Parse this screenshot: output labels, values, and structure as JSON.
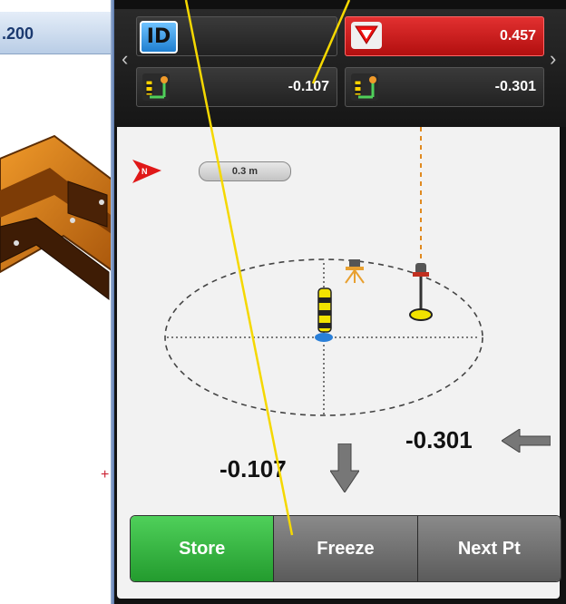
{
  "cad": {
    "header_value": ".200",
    "crosshair": "+"
  },
  "nav": {
    "left_arrow": "‹",
    "right_arrow": "›"
  },
  "top_fields": {
    "id_badge": "ID",
    "id_value": "",
    "cutfill_value": "0.457",
    "delta1_value": "-0.107",
    "delta2_value": "-0.301"
  },
  "map": {
    "scale_label": "0.3 m",
    "north_icon": "north-arrow-flag-icon",
    "instrument_icon": "total-station-icon",
    "rod_icon": "prism-rod-icon",
    "target_icon": "target-pole-icon"
  },
  "deltas": {
    "down_value": "-0.107",
    "left_value": "-0.301"
  },
  "buttons": {
    "store": "Store",
    "freeze": "Freeze",
    "next": "Next Pt"
  },
  "colors": {
    "red": "#c81818",
    "green": "#2fb53b",
    "callout": "#f5d800",
    "survey_yellow": "#f2e300"
  }
}
